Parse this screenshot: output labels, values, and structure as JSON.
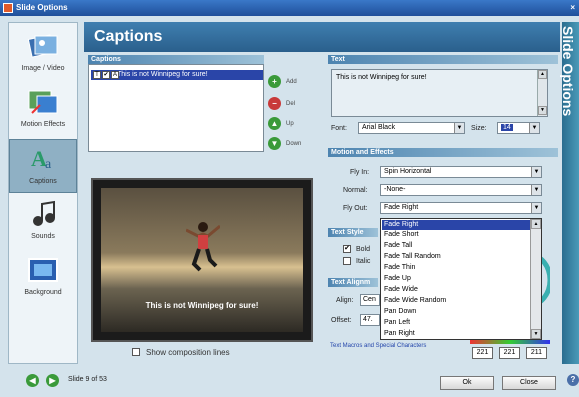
{
  "window": {
    "title": "Slide Options"
  },
  "sidebar": {
    "items": [
      {
        "label": "Image / Video",
        "icon": "image-video-icon"
      },
      {
        "label": "Motion Effects",
        "icon": "motion-effects-icon"
      },
      {
        "label": "Captions",
        "icon": "captions-icon"
      },
      {
        "label": "Sounds",
        "icon": "sounds-icon"
      },
      {
        "label": "Background",
        "icon": "background-icon"
      }
    ]
  },
  "header": {
    "title": "Captions",
    "vertical_title": "Slide Options"
  },
  "captions": {
    "group_label": "Captions",
    "item": "This is not Winnipeg for sure!",
    "check_labels": [
      "T",
      "✔",
      "A"
    ],
    "buttons": {
      "add": "Add",
      "delete": "Del",
      "up": "Up",
      "down": "Down"
    }
  },
  "text": {
    "group_label": "Text",
    "value": "This is not Winnipeg for sure!",
    "font_label": "Font:",
    "font_value": "Arial Black",
    "size_label": "Size:",
    "size_value": "14"
  },
  "motion": {
    "group_label": "Motion and Effects",
    "fly_in_label": "Fly In:",
    "fly_in_value": "Spin Horizontal",
    "normal_label": "Normal:",
    "normal_value": "-None-",
    "fly_out_label": "Fly Out:",
    "fly_out_value": "Fade Right",
    "dropdown_options": [
      "Fade Right",
      "Fade Short",
      "Fade Tall",
      "Fade Tall Random",
      "Fade Thin",
      "Fade Up",
      "Fade Wide",
      "Fade Wide Random",
      "Pan Down",
      "Pan Left",
      "Pan Right"
    ]
  },
  "text_style": {
    "group_label": "Text Style",
    "bold_label": "Bold",
    "bold_checked": "✔",
    "italic_label": "Italic"
  },
  "text_align": {
    "group_label": "Text Alignm",
    "align_label": "Align:",
    "align_value": "Cen",
    "offset_label": "Offset:",
    "offset_value": "47."
  },
  "preview": {
    "caption": "This is not Winnipeg for sure!",
    "composition_label": "Show composition lines"
  },
  "color": {
    "r": "221",
    "g": "221",
    "b": "211"
  },
  "link": {
    "text": "Text Macros and Special Characters"
  },
  "footer": {
    "slide_label": "Slide 9 of 53",
    "ok": "Ok",
    "close": "Close",
    "help": "?"
  },
  "colors": {
    "accent": "#2a45a8",
    "header_bg": "#3f7fb0",
    "nav_green": "#3a9a3a"
  }
}
